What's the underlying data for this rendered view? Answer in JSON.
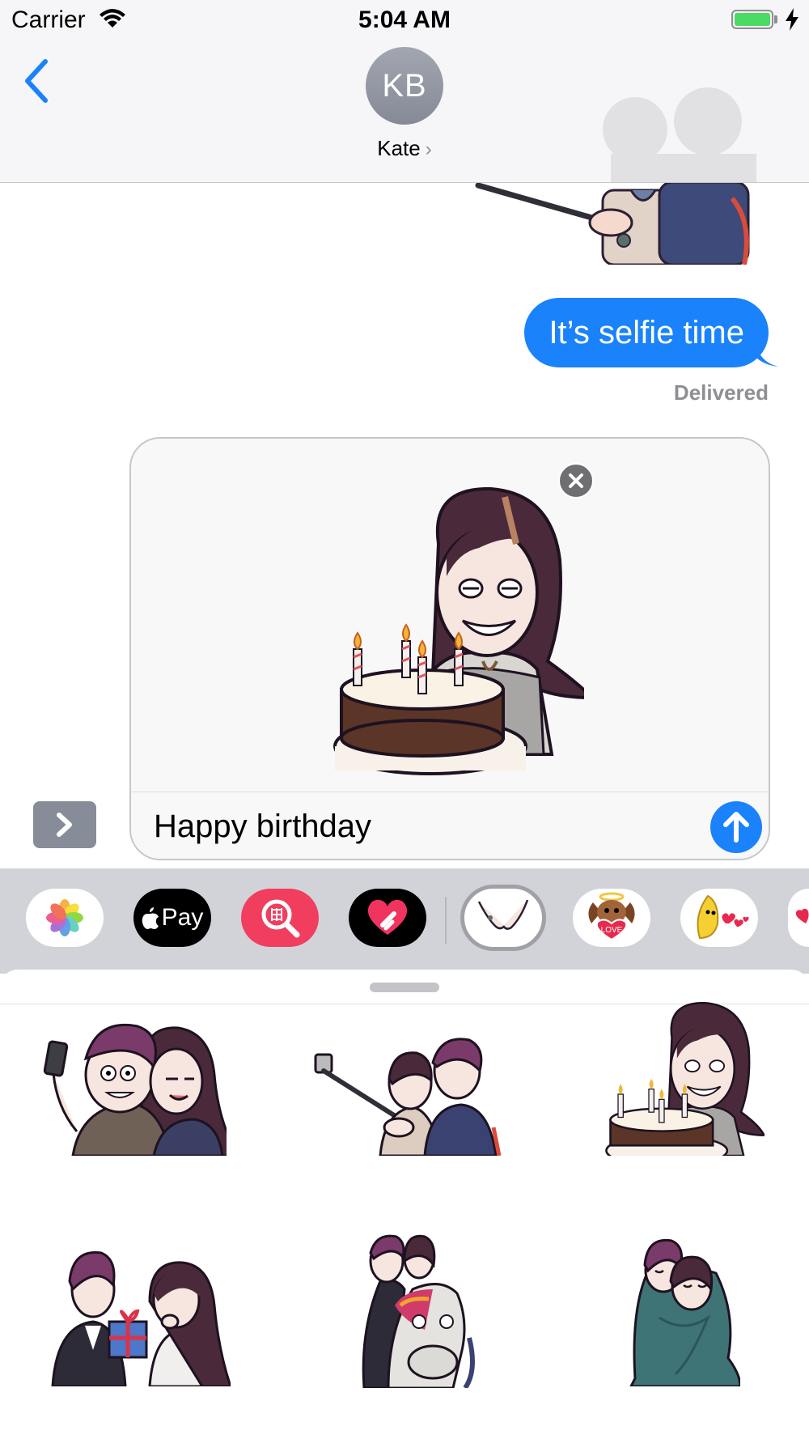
{
  "status_bar": {
    "carrier": "Carrier",
    "time": "5:04 AM",
    "battery_color": "#4cd964"
  },
  "header": {
    "avatar_initials": "KB",
    "contact_name": "Kate",
    "chevron": "›"
  },
  "conversation": {
    "sent_message": "It’s selfie time",
    "receipt": "Delivered",
    "bubble_color": "#1a82fb"
  },
  "compose": {
    "attached_sticker": "birthday-cake-sticker",
    "message_text": "Happy birthday"
  },
  "app_drawer": {
    "apps": [
      {
        "name": "photos-app-icon"
      },
      {
        "name": "apple-pay-app-icon",
        "label": "Pay"
      },
      {
        "name": "images-search-app-icon"
      },
      {
        "name": "digital-touch-app-icon"
      },
      {
        "name": "couple-stickers-app-icon",
        "selected": true
      },
      {
        "name": "dog-angel-sticker-app-icon",
        "label": "LOVE"
      },
      {
        "name": "banana-hearts-sticker-app-icon"
      }
    ]
  },
  "sticker_browser": {
    "stickers": [
      "selfie-couple-sticker",
      "selfie-stick-couple-sticker",
      "birthday-cake-sticker",
      "gift-couple-sticker",
      "horse-couple-sticker",
      "blanket-hug-sticker"
    ]
  }
}
